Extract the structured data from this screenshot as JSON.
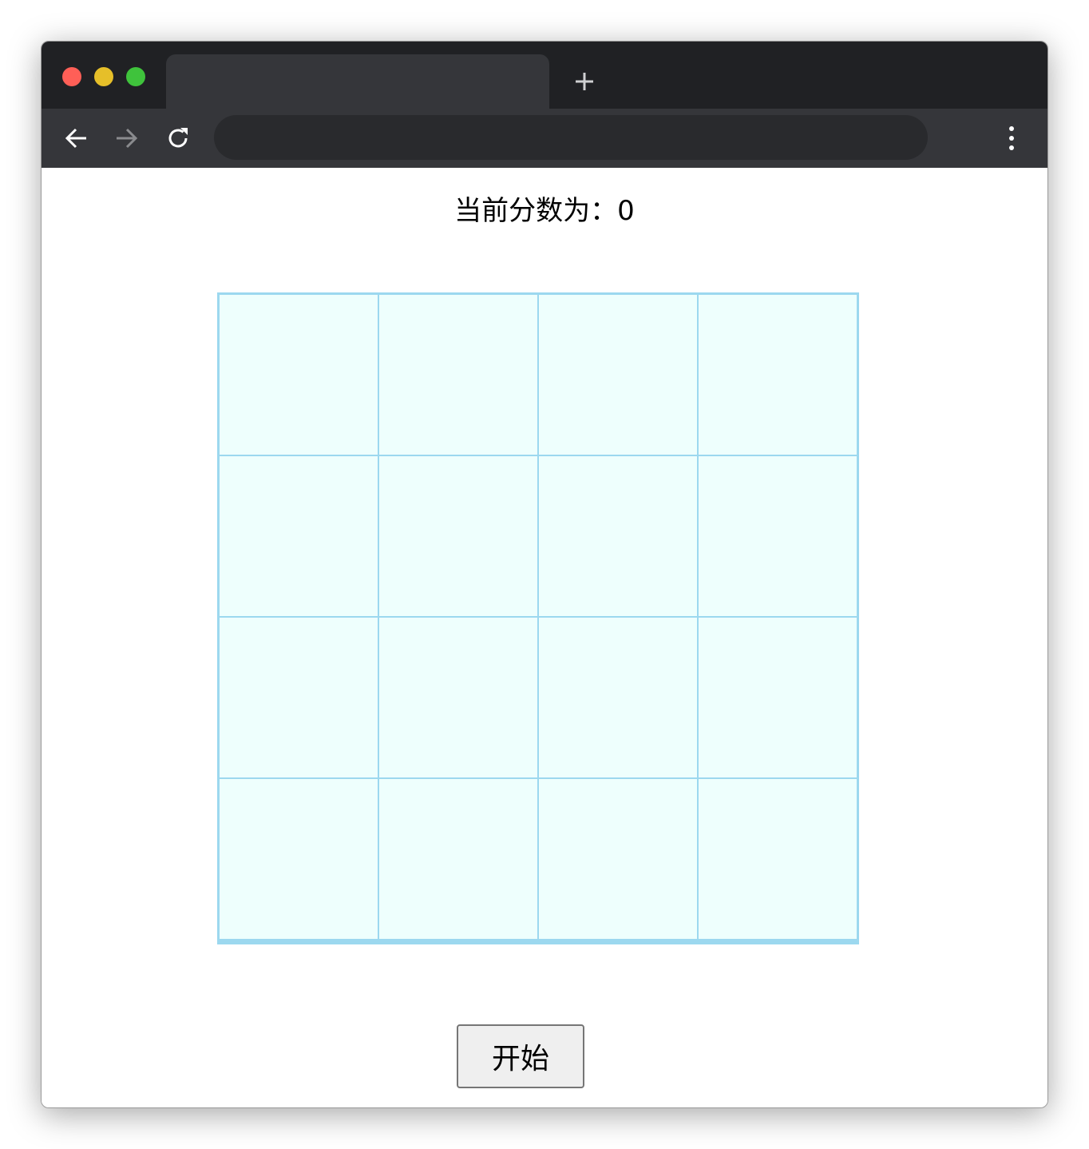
{
  "browser": {
    "tab_title": "",
    "address": "",
    "colors": {
      "close": "#ff5f57",
      "minimize": "#e6bf29",
      "maximize": "#3fc33c",
      "tabbar": "#202124",
      "toolbar": "#35363a"
    },
    "icons": {
      "new_tab": "plus-icon",
      "back": "arrow-left-icon",
      "forward": "arrow-right-icon",
      "reload": "reload-icon",
      "menu": "kebab-menu-icon"
    }
  },
  "game": {
    "score_text": "当前分数为：0",
    "score_value": 0,
    "rows": 4,
    "cols": 4,
    "cells": [
      [
        "",
        "",
        "",
        ""
      ],
      [
        "",
        "",
        "",
        ""
      ],
      [
        "",
        "",
        "",
        ""
      ],
      [
        "",
        "",
        "",
        ""
      ]
    ],
    "start_label": "开始",
    "colors": {
      "cell_bg": "#eefffd",
      "cell_border": "#9cd8ef"
    }
  }
}
